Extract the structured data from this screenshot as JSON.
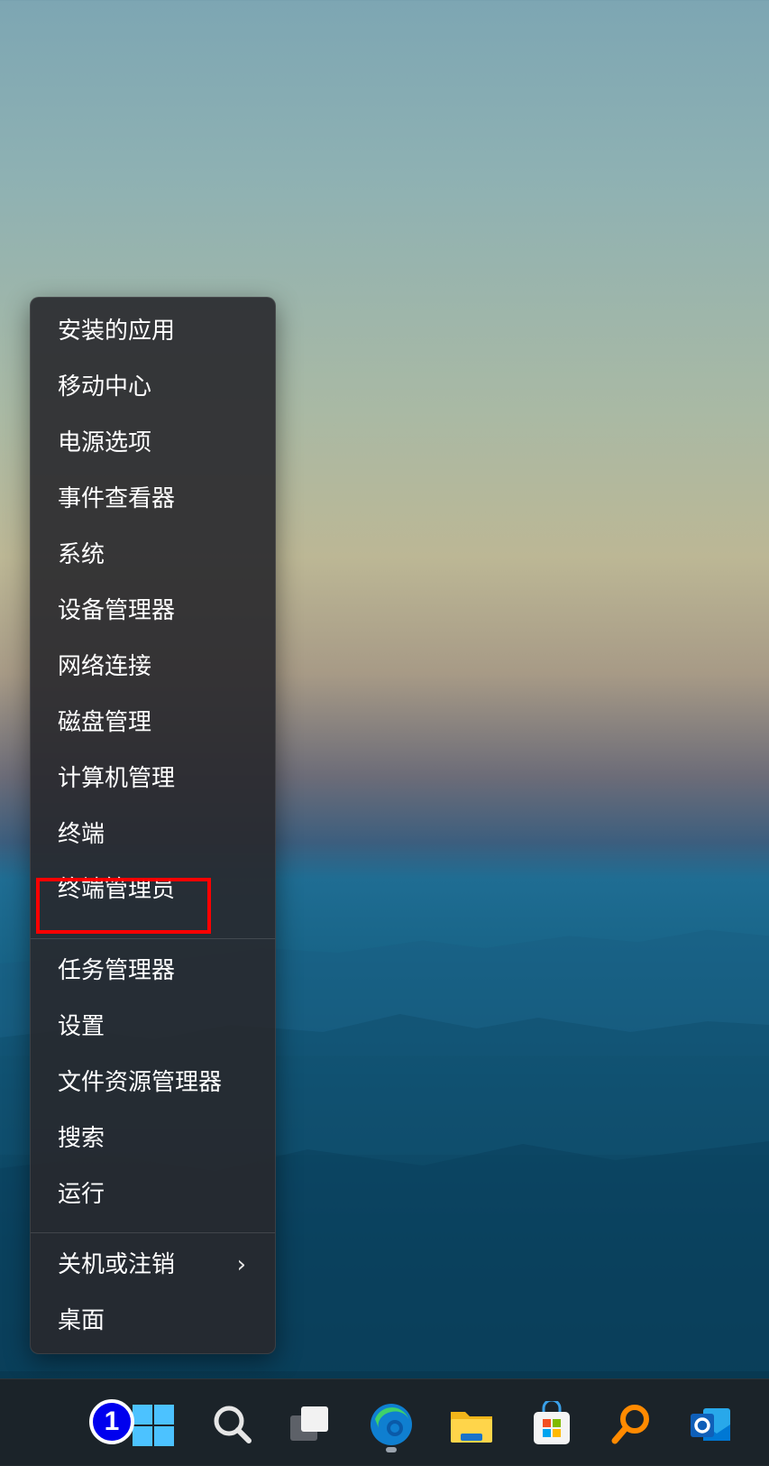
{
  "menu": {
    "items": [
      {
        "label": "安装的应用"
      },
      {
        "label": "移动中心"
      },
      {
        "label": "电源选项"
      },
      {
        "label": "事件查看器"
      },
      {
        "label": "系统"
      },
      {
        "label": "设备管理器"
      },
      {
        "label": "网络连接"
      },
      {
        "label": "磁盘管理"
      },
      {
        "label": "计算机管理"
      },
      {
        "label": "终端"
      },
      {
        "label": "终端管理员"
      },
      {
        "label": "任务管理器"
      },
      {
        "label": "设置"
      },
      {
        "label": "文件资源管理器"
      },
      {
        "label": "搜索"
      },
      {
        "label": "运行"
      },
      {
        "label": "关机或注销",
        "submenu_icon": "chevron-right-icon"
      },
      {
        "label": "桌面"
      }
    ],
    "highlighted_item": "终端管理员",
    "highlight_color": "#ff0000"
  },
  "taskbar": {
    "badge_number": "1",
    "badge_color": "#0000ee",
    "icons": [
      {
        "name": "windows-start-icon"
      },
      {
        "name": "search-icon"
      },
      {
        "name": "task-view-icon"
      },
      {
        "name": "edge-browser-icon"
      },
      {
        "name": "file-explorer-icon"
      },
      {
        "name": "microsoft-store-icon"
      },
      {
        "name": "search-app-icon"
      },
      {
        "name": "outlook-icon"
      }
    ]
  }
}
